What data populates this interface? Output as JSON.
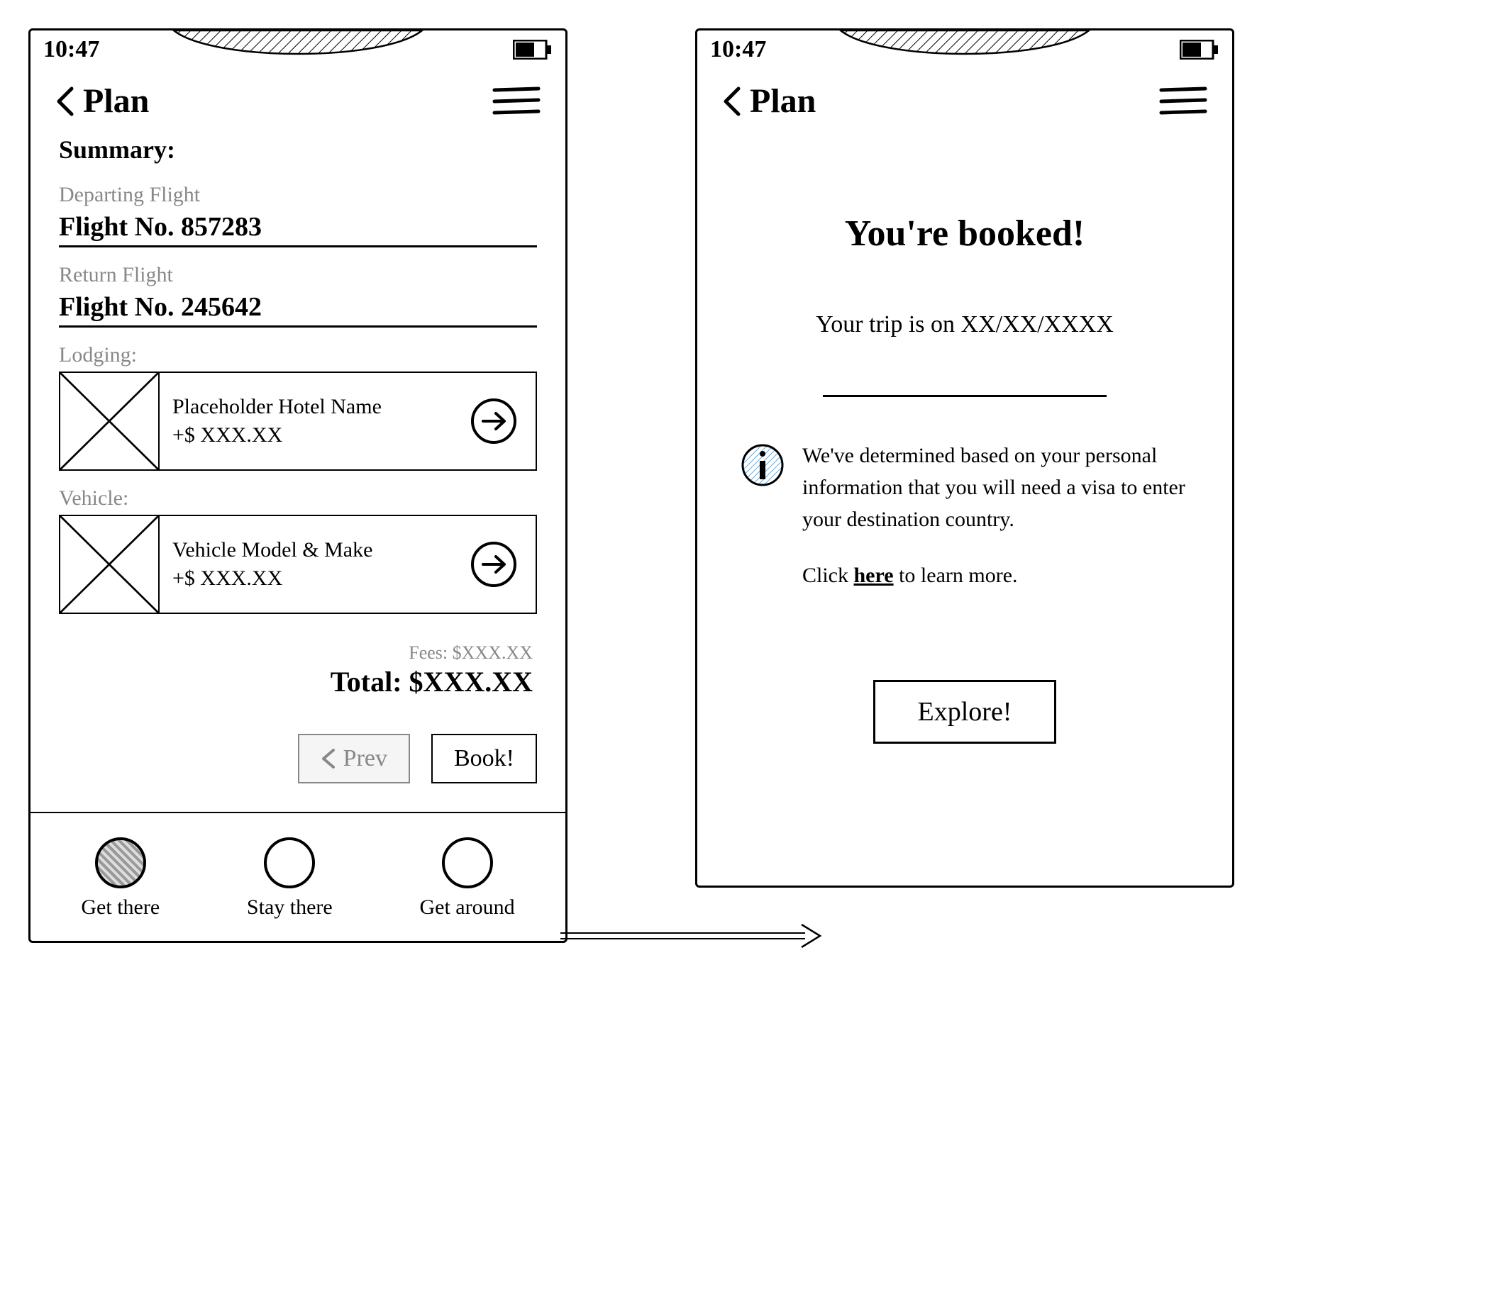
{
  "status": {
    "time": "10:47"
  },
  "header": {
    "title": "Plan"
  },
  "screen1": {
    "summary_heading": "Summary:",
    "departing_label": "Departing Flight",
    "departing_value": "Flight No. 857283",
    "return_label": "Return Flight",
    "return_value": "Flight No. 245642",
    "lodging_label": "Lodging:",
    "lodging_name": "Placeholder Hotel Name",
    "lodging_price": "+$ XXX.XX",
    "vehicle_label": "Vehicle:",
    "vehicle_name": "Vehicle Model & Make",
    "vehicle_price": "+$ XXX.XX",
    "fees_line": "Fees: $XXX.XX",
    "total_line": "Total: $XXX.XX",
    "prev_btn": "Prev",
    "book_btn": "Book!"
  },
  "tabs": {
    "get_there": "Get there",
    "stay_there": "Stay there",
    "get_around": "Get around"
  },
  "screen2": {
    "title": "You're booked!",
    "date_line": "Your trip is on XX/XX/XXXX",
    "visa_info": "We've determined based on your personal information that you will need a visa to enter your destination country.",
    "learn_prefix": "Click ",
    "learn_link": "here",
    "learn_suffix": " to learn more.",
    "explore_btn": "Explore!"
  }
}
